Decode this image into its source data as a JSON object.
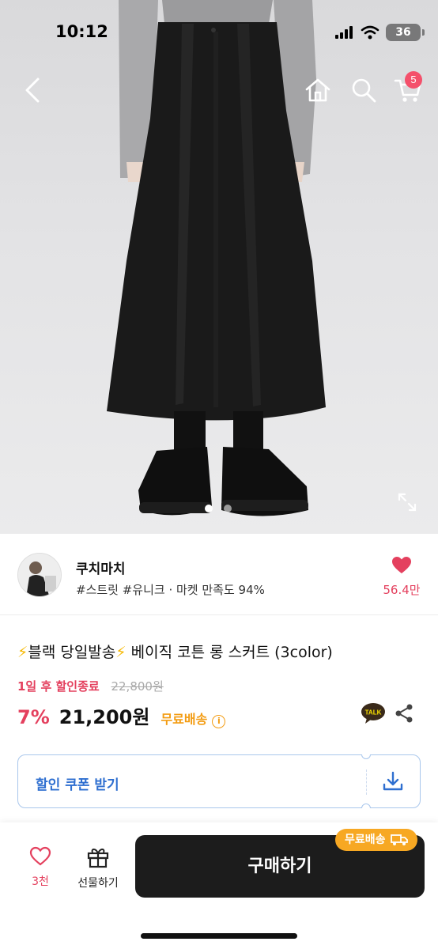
{
  "status_bar": {
    "time": "10:12",
    "battery": "36"
  },
  "nav": {
    "cart_count": "5"
  },
  "gallery": {
    "slide_count": 2,
    "active_slide": 1
  },
  "seller": {
    "name": "쿠치마치",
    "tags": "#스트릿 #유니크 · 마켓 만족도 94%",
    "like_count": "56.4만"
  },
  "product": {
    "title_prefix": "블랙 당일발송",
    "title_suffix": " 베이직 코튼 롱 스커트 (3color)",
    "sale_label": "1일 후 할인종료",
    "original_price": "22,800원",
    "discount": "7%",
    "price": "21,200원",
    "free_shipping": "무료배송",
    "info": "i"
  },
  "coupon": {
    "label": "할인 쿠폰 받기"
  },
  "bottom_bar": {
    "like_count": "3천",
    "gift_label": "선물하기",
    "buy_label": "구매하기",
    "shipping_badge": "무료배송"
  },
  "colors": {
    "accent_red": "#e4405e",
    "shipping_orange": "#f7a823",
    "coupon_blue": "#2f6fd0",
    "buy_button": "#1c1c1c"
  },
  "icons": [
    "back-arrow-icon",
    "home-icon",
    "search-icon",
    "cart-icon",
    "expand-icon",
    "heart-icon",
    "kakao-talk-icon",
    "share-icon",
    "download-icon",
    "gift-icon",
    "truck-icon",
    "info-icon"
  ]
}
